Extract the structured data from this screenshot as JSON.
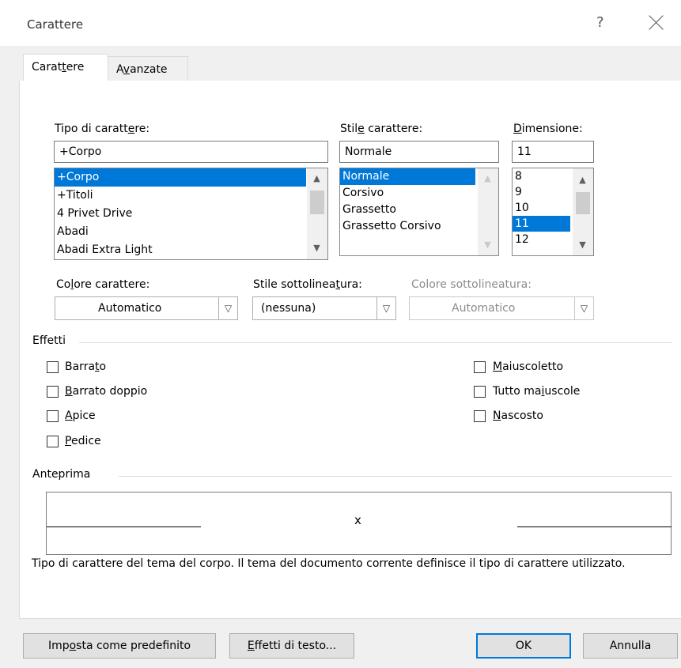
{
  "dialog": {
    "title": "Carattere",
    "help": "?"
  },
  "tabs": [
    {
      "label_pre": "Carat",
      "label_u": "t",
      "label_post": "ere",
      "active": true
    },
    {
      "label_pre": "A",
      "label_u": "v",
      "label_post": "anzate",
      "active": false
    }
  ],
  "font": {
    "label": "Tipo di caratt",
    "label_u": "e",
    "label_post": "re:",
    "value": "+Corpo",
    "items": [
      "+Corpo",
      "+Titoli",
      "4 Privet Drive",
      "Abadi",
      "Abadi Extra Light"
    ],
    "selected_index": 0
  },
  "style": {
    "label_pre": "Stil",
    "label_u": "e",
    "label_post": " carattere:",
    "value": "Normale",
    "items": [
      "Normale",
      "Corsivo",
      "Grassetto",
      "Grassetto Corsivo"
    ],
    "selected_index": 0
  },
  "size": {
    "label_pre": "",
    "label_u": "D",
    "label_post": "imensione:",
    "value": "11",
    "items": [
      "8",
      "9",
      "10",
      "11",
      "12"
    ],
    "selected_index": 3
  },
  "font_color": {
    "label_pre": "Co",
    "label_u": "l",
    "label_post": "ore carattere:",
    "value": "Automatico"
  },
  "underline_style": {
    "label_pre": "Stile sottolinea",
    "label_u": "t",
    "label_post": "ura:",
    "value": "(nessuna)"
  },
  "underline_color": {
    "label": "Colore sottolineatura:",
    "value": "Automatico"
  },
  "effects": {
    "title": "Effetti",
    "left": [
      {
        "pre": "Barra",
        "u": "t",
        "post": "o",
        "checked": false
      },
      {
        "pre": "",
        "u": "B",
        "post": "arrato doppio",
        "checked": false
      },
      {
        "pre": "",
        "u": "A",
        "post": "pice",
        "checked": false
      },
      {
        "pre": "",
        "u": "P",
        "post": "edice",
        "checked": false
      }
    ],
    "right": [
      {
        "pre": "",
        "u": "M",
        "post": "aiuscoletto",
        "checked": false
      },
      {
        "pre": "Tutto ma",
        "u": "i",
        "post": "uscole",
        "checked": false
      },
      {
        "pre": "",
        "u": "N",
        "post": "ascosto",
        "checked": false
      }
    ]
  },
  "preview": {
    "title": "Anteprima",
    "sample": "x",
    "description": "Tipo di carattere del tema del corpo. Il tema del documento corrente definisce il tipo di carattere utilizzato."
  },
  "buttons": {
    "set_default_pre": "Imp",
    "set_default_u": "o",
    "set_default_post": "sta come predefinito",
    "text_effects_pre": "",
    "text_effects_u": "E",
    "text_effects_post": "ffetti di testo...",
    "ok": "OK",
    "cancel": "Annulla"
  }
}
